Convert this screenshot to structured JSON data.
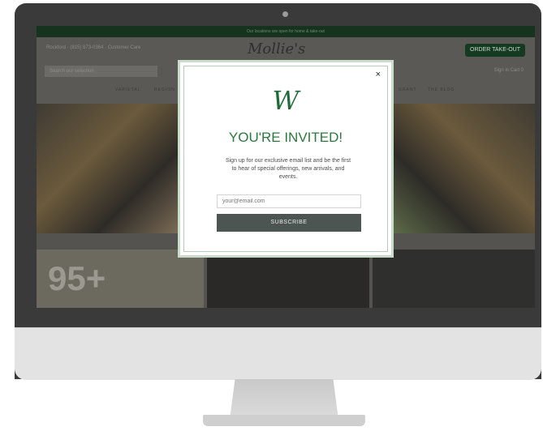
{
  "site": {
    "announcement": "Our locations are open for home & take-out",
    "location": "Rockford  ·  (815) 873-0364  ·  Customer Care",
    "logo_text": "Mollie's",
    "order_button": "ORDER TAKE-OUT",
    "search_placeholder": "Search our selection",
    "account_links": "Sign in    Cart  0",
    "menu_left": [
      "VARIETAL",
      "REGION"
    ],
    "menu_right": [
      "GRANT",
      "THE BLOG"
    ],
    "promo_tile": "95+"
  },
  "modal": {
    "logo_mark": "W",
    "close_label": "×",
    "title": "YOU'RE INVITED!",
    "description": "Sign up for our exclusive email list and be the first to hear of special offerings, new arrivals, and events.",
    "email_placeholder": "your@email.com",
    "subscribe_label": "SUBSCRIBE"
  }
}
